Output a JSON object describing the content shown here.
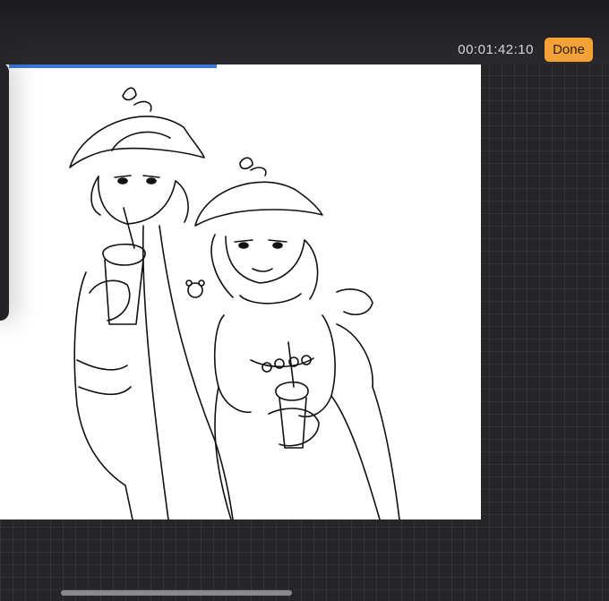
{
  "toolbar": {
    "timer_text": "00:01:42:10",
    "done_label": "Done"
  },
  "export": {
    "progress_fraction": 0.44
  },
  "colors": {
    "accent": "#f4a236",
    "progress": "#3a78d8",
    "background": "#262628",
    "canvas": "#ffffff"
  },
  "icons": {
    "side_panel": "side-tool-panel"
  }
}
